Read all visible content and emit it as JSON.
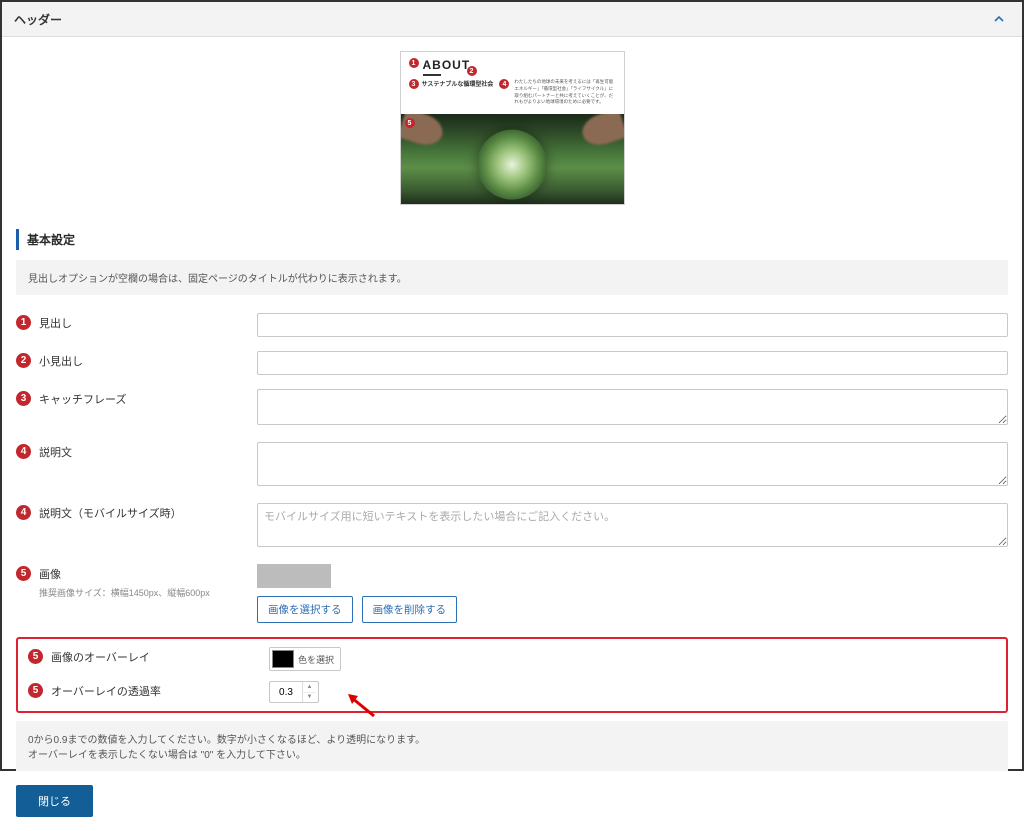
{
  "header": {
    "title": "ヘッダー"
  },
  "preview": {
    "about": "ABOUT",
    "sub": "サステナブルな循環型社会",
    "desc": "わたしたちの地球の未来を考えるには「再生可能エネルギー」「循環型社会」「ライフサイクル」に取り組むパートナーと共に考えていくことが、だれもがよりよい地球環境のために必要です。"
  },
  "section": {
    "title": "基本設定"
  },
  "notice": "見出しオプションが空欄の場合は、固定ページのタイトルが代わりに表示されます。",
  "fields": {
    "heading": {
      "num": "1",
      "label": "見出し"
    },
    "subheading": {
      "num": "2",
      "label": "小見出し"
    },
    "catch": {
      "num": "3",
      "label": "キャッチフレーズ"
    },
    "desc": {
      "num": "4",
      "label": "説明文"
    },
    "desc_mobile": {
      "num": "4",
      "label": "説明文（モバイルサイズ時）",
      "placeholder": "モバイルサイズ用に短いテキストを表示したい場合にご記入ください。"
    },
    "image": {
      "num": "5",
      "label": "画像",
      "hint": "推奨画像サイズ：横幅1450px、縦幅600px",
      "select_btn": "画像を選択する",
      "delete_btn": "画像を削除する"
    },
    "overlay_color": {
      "num": "5",
      "label": "画像のオーバーレイ",
      "picker_label": "色を選択",
      "color": "#000000"
    },
    "overlay_opacity": {
      "num": "5",
      "label": "オーバーレイの透過率",
      "value": "0.3"
    }
  },
  "help": {
    "line1": "0から0.9までの数値を入力してください。数字が小さくなるほど、より透明になります。",
    "line2": "オーバーレイを表示したくない場合は \"0\" を入力して下さい。"
  },
  "buttons": {
    "close": "閉じる"
  }
}
